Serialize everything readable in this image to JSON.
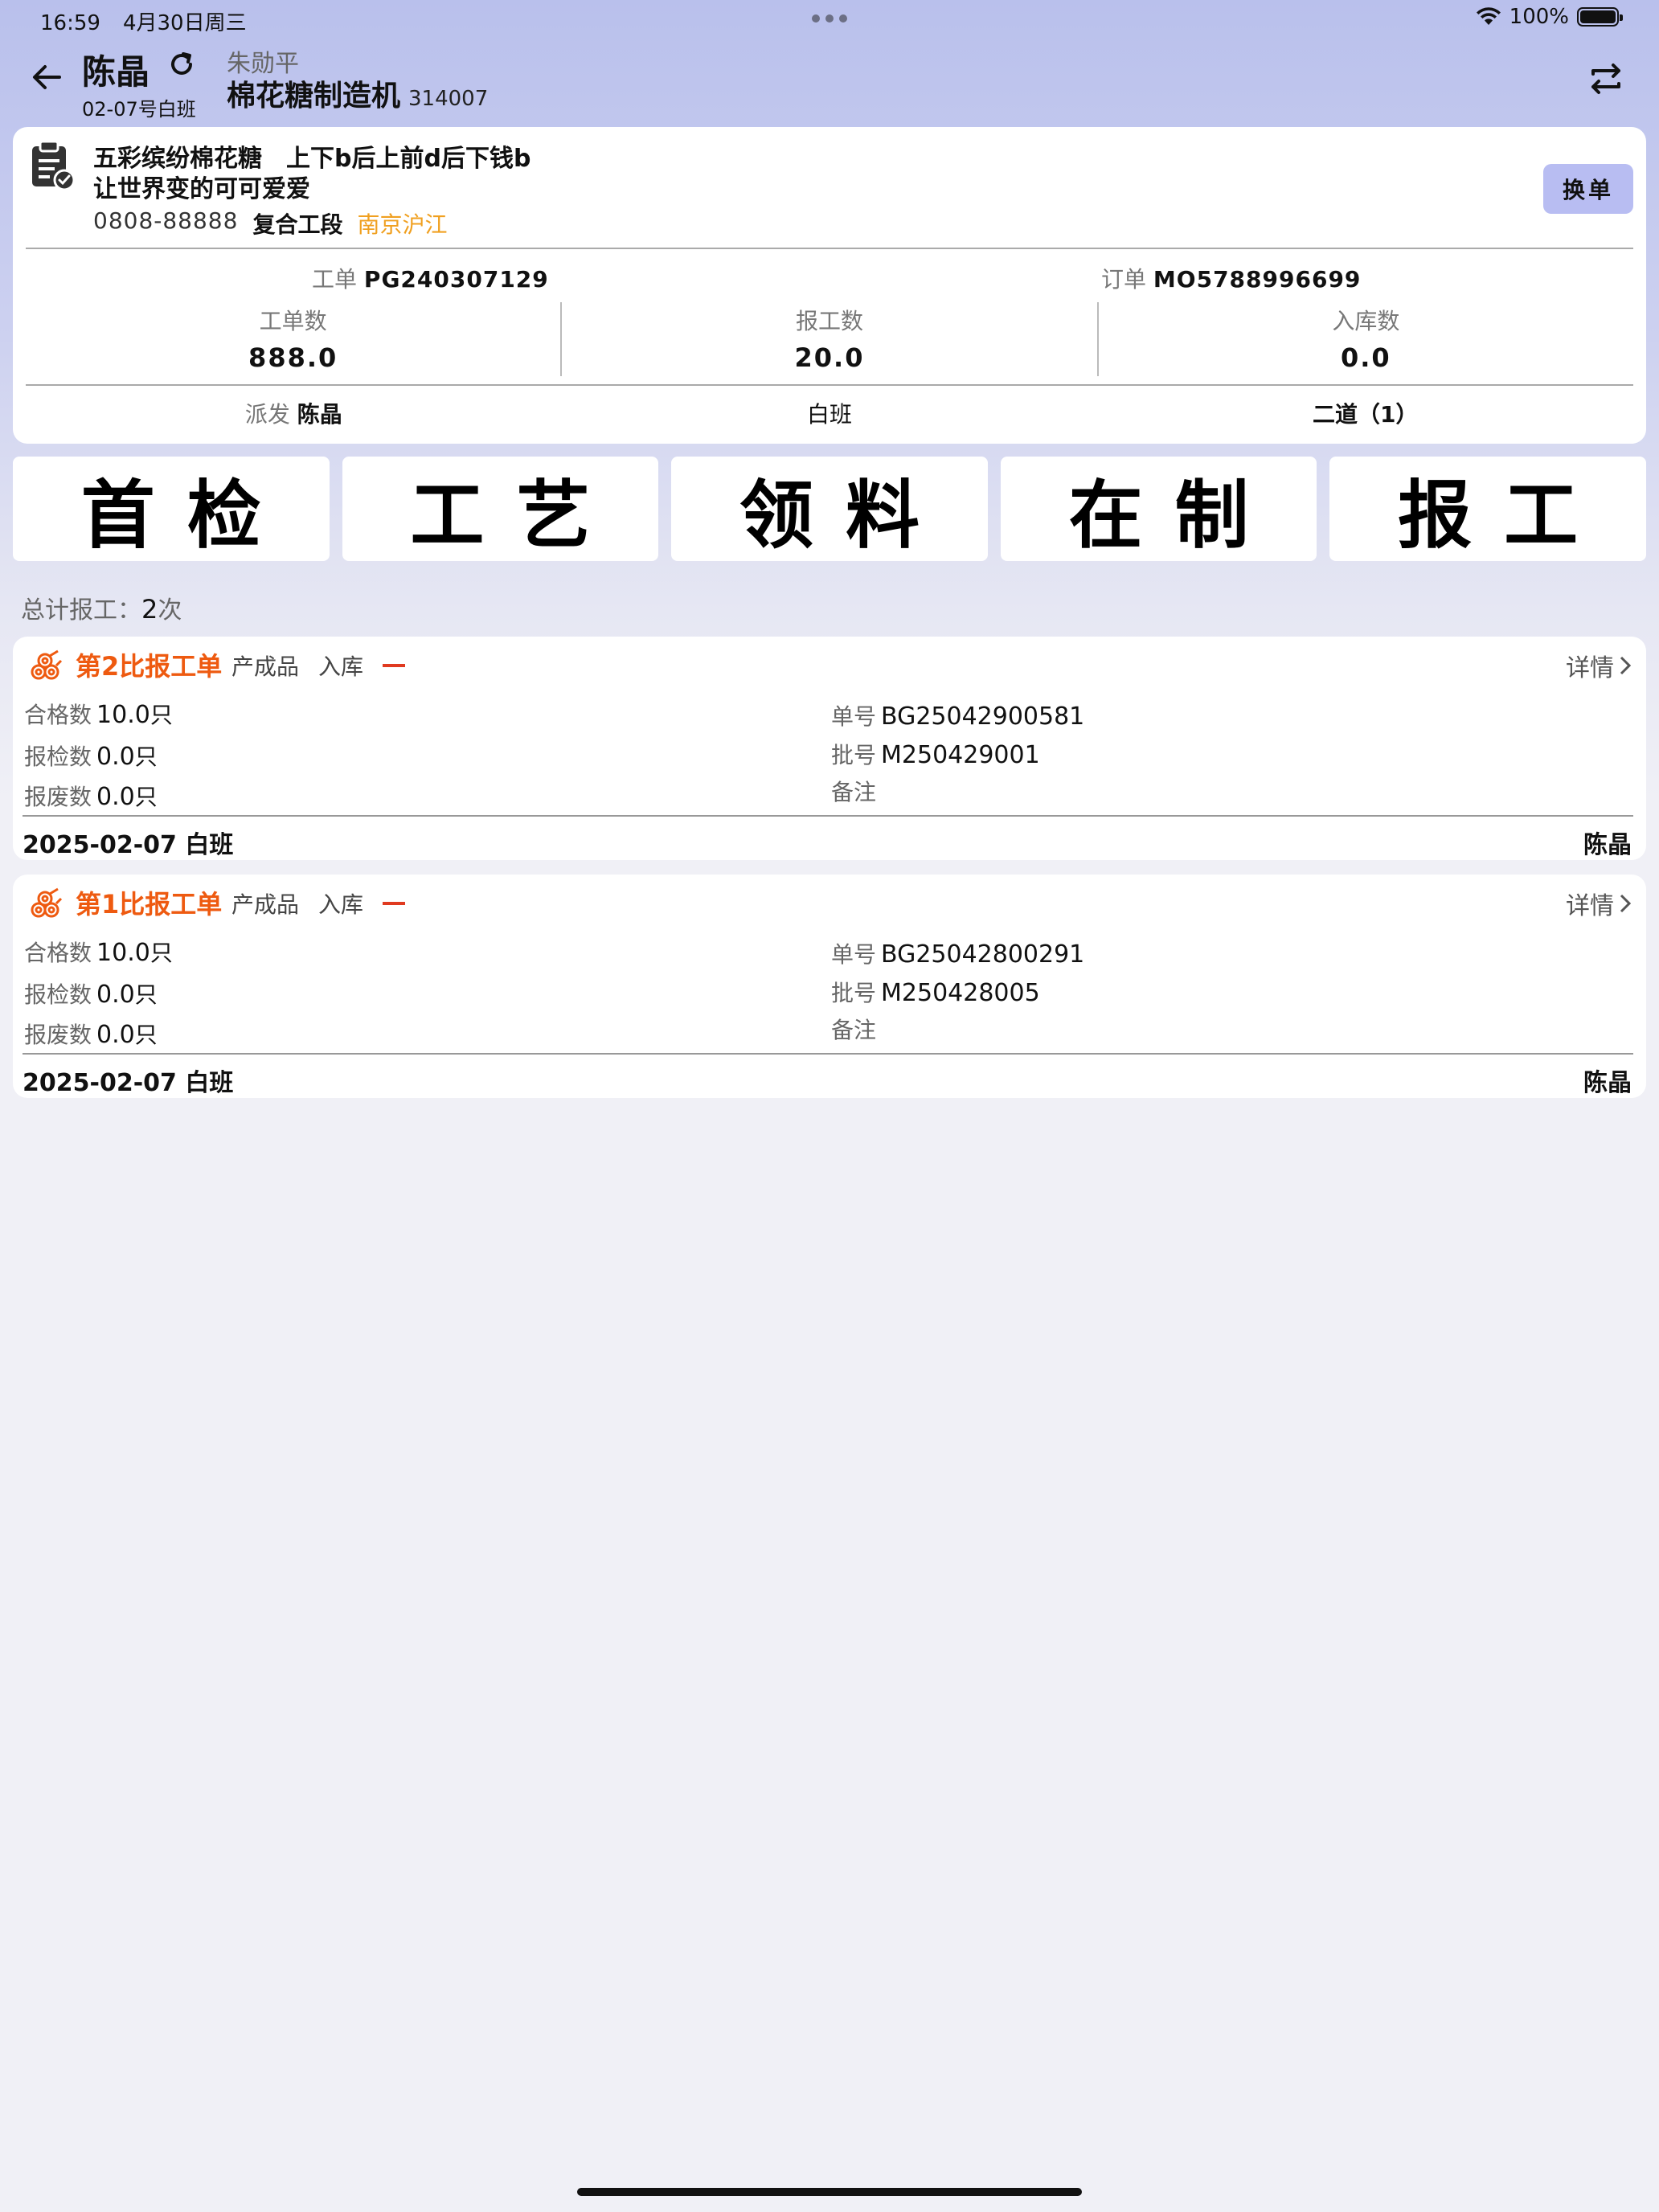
{
  "status_bar": {
    "time": "16:59",
    "date": "4月30日周三",
    "battery": "100%"
  },
  "header": {
    "operator": "陈晶",
    "shift": "02-07号白班",
    "person": "朱勋平",
    "machine": "棉花糖制造机",
    "machine_code": "314007"
  },
  "info": {
    "product_line1": "五彩缤纷棉花糖　上下b后上前d后下钱b",
    "product_line2": "让世界变的可可爱爱",
    "phone": "0808-88888",
    "section": "复合工段",
    "location": "南京沪江",
    "switch_label": "换单",
    "work_order_label": "工单",
    "work_order": "PG240307129",
    "order_label": "订单",
    "order": "MO5788996699",
    "stats": [
      {
        "label": "工单数",
        "value": "888.0"
      },
      {
        "label": "报工数",
        "value": "20.0"
      },
      {
        "label": "入库数",
        "value": "0.0"
      }
    ],
    "dispatch_label": "派发",
    "dispatch_user": "陈晶",
    "shift_type": "白班",
    "process": "二道（1）"
  },
  "actions": [
    "首检",
    "工艺",
    "领料",
    "在制",
    "报工"
  ],
  "summary": {
    "label": "总计报工：",
    "count": "2",
    "unit": "次"
  },
  "reports": [
    {
      "title": "第2比报工单",
      "type": "产成品",
      "stock": "入库",
      "detail": "详情",
      "pass_label": "合格数",
      "pass_value": "10.0",
      "pass_unit": "只",
      "inspect_label": "报检数",
      "inspect_value": "0.0",
      "inspect_unit": "只",
      "scrap_label": "报废数",
      "scrap_value": "0.0",
      "scrap_unit": "只",
      "no_label": "单号",
      "no_value": "BG25042900581",
      "batch_label": "批号",
      "batch_value": "M250429001",
      "remark_label": "备注",
      "date": "2025-02-07 白班",
      "user": "陈晶"
    },
    {
      "title": "第1比报工单",
      "type": "产成品",
      "stock": "入库",
      "detail": "详情",
      "pass_label": "合格数",
      "pass_value": "10.0",
      "pass_unit": "只",
      "inspect_label": "报检数",
      "inspect_value": "0.0",
      "inspect_unit": "只",
      "scrap_label": "报废数",
      "scrap_value": "0.0",
      "scrap_unit": "只",
      "no_label": "单号",
      "no_value": "BG25042800291",
      "batch_label": "批号",
      "batch_value": "M250428005",
      "remark_label": "备注",
      "date": "2025-02-07 白班",
      "user": "陈晶"
    }
  ],
  "colors": {
    "accent_orange": "#ee5a10",
    "location_yellow": "#f0a020",
    "switch_button": "#b8bdf2",
    "header_bg": "#b9c0ec"
  },
  "icons": [
    "back-arrow-icon",
    "refresh-icon",
    "swap-icon",
    "clipboard-check-icon",
    "pipes-icon",
    "chevron-right-icon"
  ]
}
